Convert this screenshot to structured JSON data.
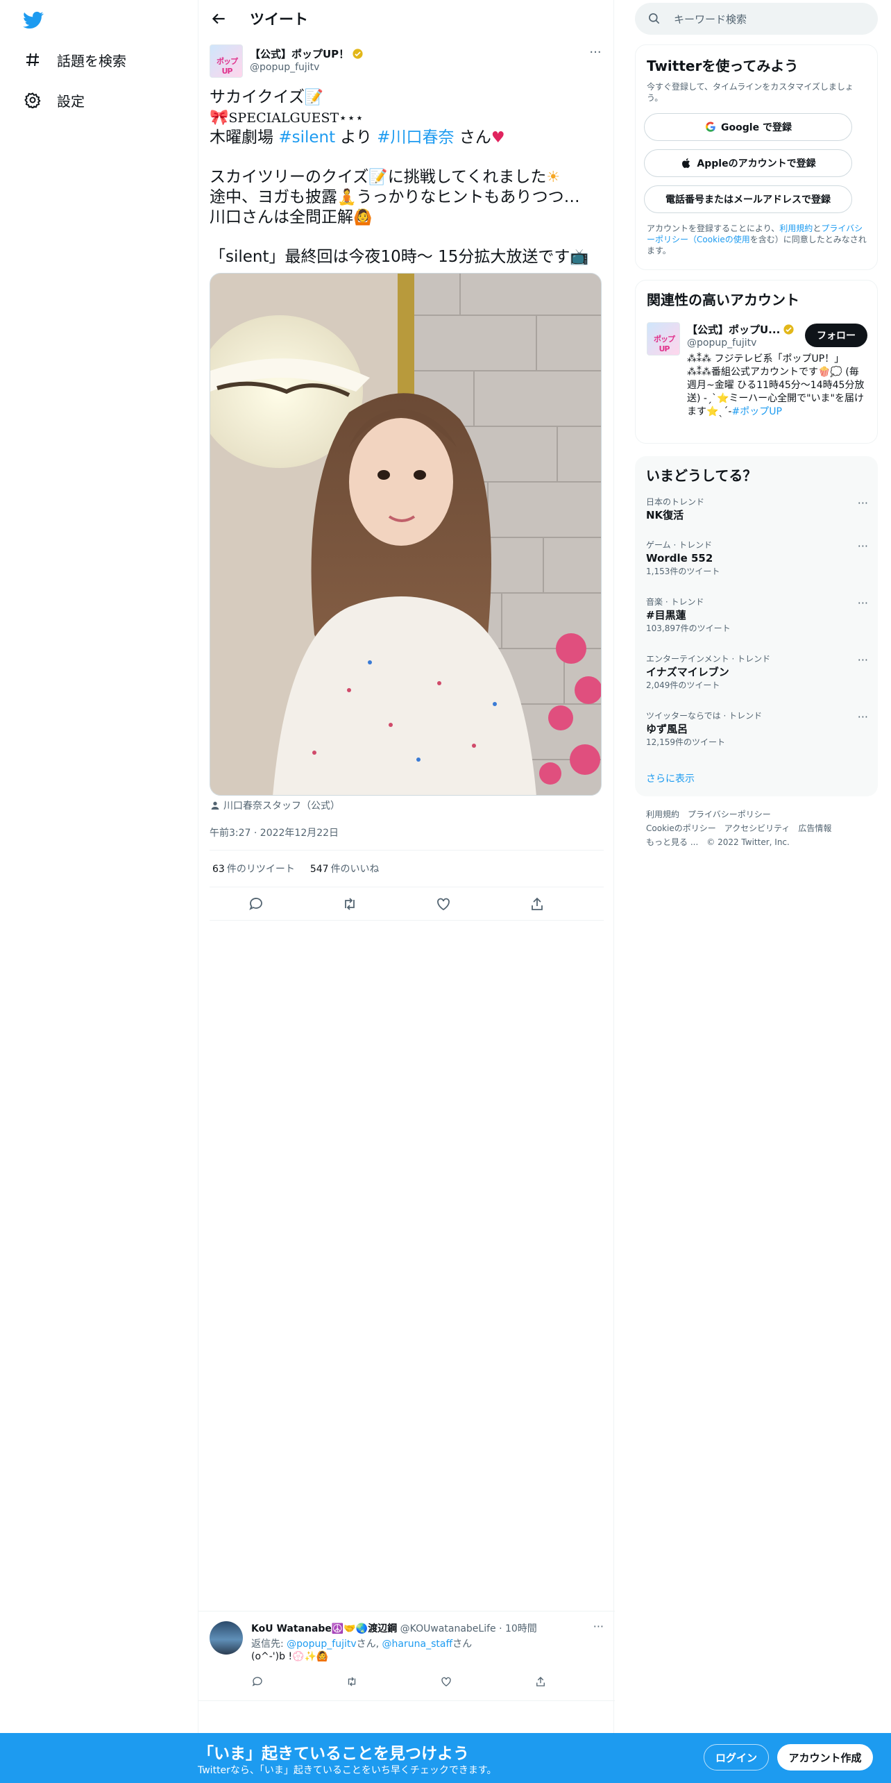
{
  "nav": {
    "explore_label": "話題を検索",
    "settings_label": "設定"
  },
  "header": {
    "title": "ツイート"
  },
  "tweet": {
    "author_name": "【公式】ポップUP！",
    "author_handle": "@popup_fujitv",
    "avatar_text": "ポップUP",
    "lines": {
      "l1": "サカイクイズ",
      "l2": "SPECIALGUEST",
      "l3_pre": "木曜劇場 ",
      "l3_tag1": "#silent",
      "l3_mid": " より ",
      "l3_tag2": "#川口春奈",
      "l3_post": " さん",
      "l4": "スカイツリーのクイズ",
      "l4b": "に挑戦してくれました",
      "l5a": "途中、ヨガも披露",
      "l5b": "うっかりなヒントもありつつ…",
      "l6": "川口さんは全問正解",
      "l7": "「silent」最終回は今夜10時～ 15分拡大放送です"
    },
    "media_credit": "川口春奈スタッフ（公式）",
    "timestamp": "午前3:27 · 2022年12月22日",
    "retweets_count": "63",
    "retweets_label": "件のリツイート",
    "likes_count": "547",
    "likes_label": "件のいいね"
  },
  "reply": {
    "name": "KoU Watanabe☮️🤝🌏渡辺鋼",
    "handle": "@KOUwatanabeLife · 10時間",
    "to_prefix": "返信先: ",
    "to_user1": "@popup_fujitv",
    "to_sep": "さん, ",
    "to_user2": "@haruna_staff",
    "to_suffix": "さん",
    "text": "(o^-')b !💮✨🙆"
  },
  "sidebar": {
    "search_placeholder": "キーワード検索",
    "signup": {
      "title": "Twitterを使ってみよう",
      "subtitle": "今すぐ登録して、タイムラインをカスタマイズしましょう。",
      "google_label": "Google で登録",
      "apple_label": "Appleのアカウントで登録",
      "phone_label": "電話番号またはメールアドレスで登録",
      "terms_pre": "アカウントを登録することにより、",
      "terms_link1": "利用規約",
      "terms_mid": "と",
      "terms_link2": "プライバシーポリシー（Cookieの使用",
      "terms_post": "を含む）に同意したとみなされます。"
    },
    "relevant": {
      "title": "関連性の高いアカウント",
      "name": "【公式】ポップU...",
      "handle": "@popup_fujitv",
      "follow_label": "フォロー",
      "bio": "⁂⁑⁂ フジテレビ系「ポップUP！」⁂⁑⁂番組公式アカウントです🍿💭 (毎週月~金曜 ひる11時45分～14時45分放送) -ˏˋ⭐ミーハー心全開で\"いま\"を届けます⭐ˎˊ-",
      "bio_tag": "#ポップUP"
    },
    "trends_title": "いまどうしてる？",
    "trends": [
      {
        "meta": "日本のトレンド",
        "name": "NK復活",
        "count": ""
      },
      {
        "meta": "ゲーム · トレンド",
        "name": "Wordle 552",
        "count": "1,153件のツイート"
      },
      {
        "meta": "音楽 · トレンド",
        "name": "#目黒蓮",
        "count": "103,897件のツイート"
      },
      {
        "meta": "エンターテインメント · トレンド",
        "name": "イナズマイレブン",
        "count": "2,049件のツイート"
      },
      {
        "meta": "ツイッターならでは · トレンド",
        "name": "ゆず風呂",
        "count": "12,159件のツイート"
      }
    ],
    "show_more": "さらに表示",
    "footer": {
      "f1": "利用規約",
      "f2": "プライバシーポリシー",
      "f3": "Cookieのポリシー",
      "f4": "アクセシビリティ",
      "f5": "広告情報",
      "f6": "もっと見る ...",
      "f7": "© 2022 Twitter, Inc."
    }
  },
  "bottom_bar": {
    "title": "「いま」起きていることを見つけよう",
    "subtitle": "Twitterなら、「いま」起きていることをいち早くチェックできます。",
    "login_label": "ログイン",
    "signup_label": "アカウント作成"
  },
  "colors": {
    "accent": "#1d9bf0",
    "text": "#0f1419",
    "muted": "#536471"
  }
}
